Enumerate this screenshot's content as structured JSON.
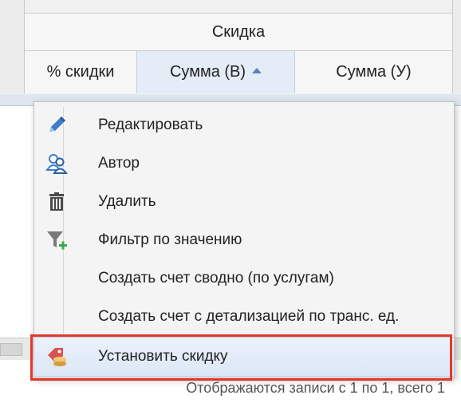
{
  "grid": {
    "group_header": "Скидка",
    "columns": [
      {
        "label": "% скидки",
        "sorted": false
      },
      {
        "label": "Сумма (В)",
        "sorted": true,
        "sort_direction": "asc"
      },
      {
        "label": "Сумма (У)",
        "sorted": false
      }
    ]
  },
  "pager": {
    "status_text": "Отображаются записи с 1 по 1, всего 1"
  },
  "context_menu": {
    "items": [
      {
        "label": "Редактировать",
        "icon": "pencil-icon"
      },
      {
        "label": "Автор",
        "icon": "users-icon"
      },
      {
        "label": "Удалить",
        "icon": "trash-icon"
      },
      {
        "label": "Фильтр по значению",
        "icon": "filter-add-icon"
      },
      {
        "label": "Создать счет сводно (по услугам)",
        "icon": ""
      },
      {
        "label": "Создать счет с детализацией по транс. ед.",
        "icon": ""
      },
      {
        "label": "Установить скидку",
        "icon": "discount-tag-icon",
        "active": true
      }
    ]
  },
  "colors": {
    "highlight": "#e0392b",
    "accent": "#5a82b8",
    "filter_plus": "#3aa84a"
  }
}
